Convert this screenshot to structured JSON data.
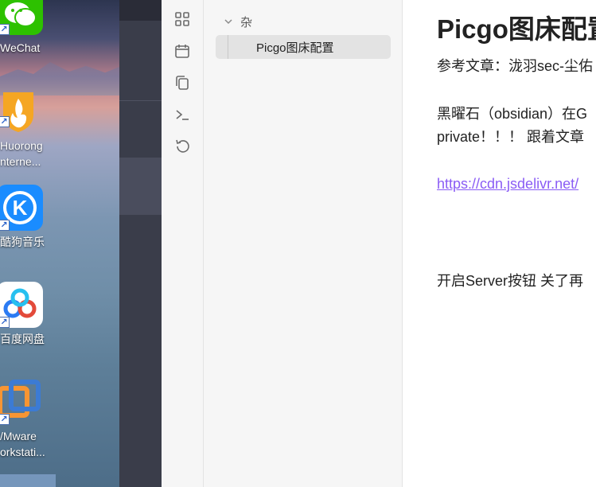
{
  "desktop": {
    "icons": [
      {
        "name": "wechat",
        "label": "WeChat",
        "color": "#2dc100"
      },
      {
        "name": "huorong",
        "label_line1": "Huorong",
        "label_line2": "nterne...",
        "color": "#f08a1c"
      },
      {
        "name": "kugou",
        "label": "酷狗音乐",
        "color": "#1a8cff"
      },
      {
        "name": "baidu-netdisk",
        "label": "百度网盘",
        "color": "#ffffff"
      },
      {
        "name": "vmware",
        "label_line1": "/Mware",
        "label_line2": "orkstati...",
        "color": "#3c7bd4"
      }
    ]
  },
  "ribbon": {
    "icons": [
      "grid-icon",
      "calendar-icon",
      "copy-icon",
      "terminal-icon",
      "history-icon"
    ]
  },
  "explorer": {
    "folder": "杂",
    "files": [
      {
        "name": "Picgo图床配置",
        "active": true
      }
    ]
  },
  "editor": {
    "title": "Picgo图床配置",
    "paragraphs": [
      "参考文章：泷羽sec-尘佑",
      "黑曜石（obsidian）在G",
      "private！！！ 跟着文章"
    ],
    "link": "https://cdn.jsdelivr.net/",
    "paragraph_after": "开启Server按钮 关了再"
  },
  "colors": {
    "link": "#8a5cf5",
    "sidebar_bg": "#f6f6f6",
    "active_file_bg": "#e3e3e3"
  }
}
